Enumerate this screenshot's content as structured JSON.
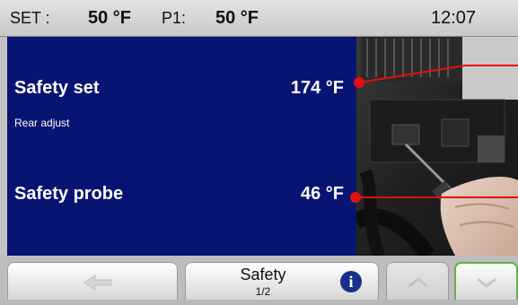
{
  "status_bar": {
    "set_label": "SET :",
    "set_value": "50 °F",
    "p1_label": "P1:",
    "p1_value": "50 °F",
    "time": "12:07"
  },
  "panel": {
    "safety_set_label": "Safety set",
    "safety_set_value": "174 °F",
    "safety_set_sub": "Rear adjust",
    "safety_probe_label": "Safety probe",
    "safety_probe_value": "46 °F"
  },
  "bottom_bar": {
    "back_icon": "arrow-left-icon",
    "title": "Safety",
    "page": "1/2",
    "info_icon": "info-icon",
    "info_glyph": "i",
    "up_icon": "chevron-up-icon",
    "down_icon": "chevron-down-icon"
  },
  "colors": {
    "panel_blue": "#071472",
    "callout_red": "#e01010",
    "active_button_border": "#5fb04b"
  }
}
